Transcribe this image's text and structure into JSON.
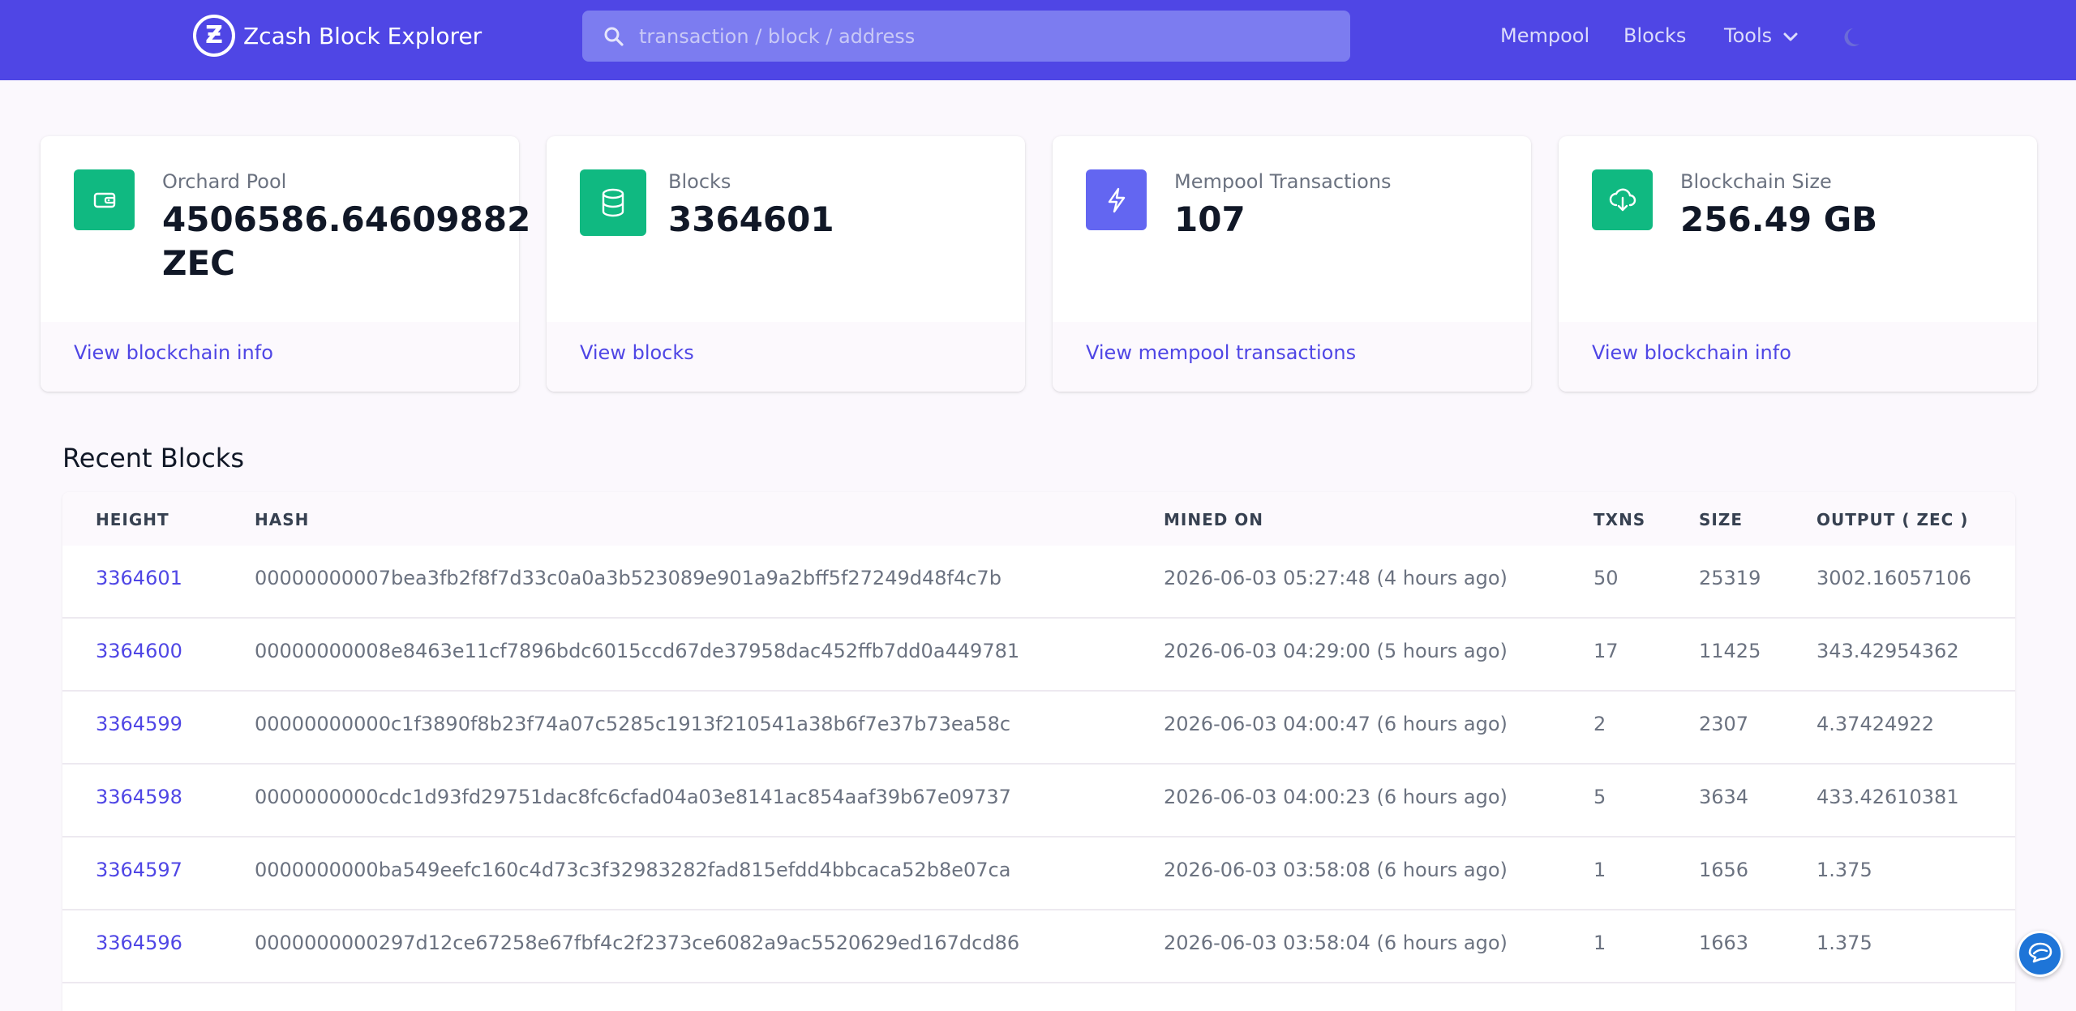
{
  "header": {
    "title": "Zcash Block Explorer",
    "logo_glyph": "Ƶ",
    "search_placeholder": "transaction / block / address",
    "nav": {
      "mempool": "Mempool",
      "blocks": "Blocks",
      "tools": "Tools"
    },
    "colors": {
      "background": "#4f46e5",
      "search_bg": "#7c7cf0"
    }
  },
  "cards": [
    {
      "label": "Orchard Pool",
      "value": "4506586.64609882\nZEC",
      "link": "View blockchain info",
      "icon": "wallet-icon",
      "icon_color": "#10b981"
    },
    {
      "label": "Blocks",
      "value": "3364601",
      "link": "View blocks",
      "icon": "database-icon",
      "icon_color": "#10b981"
    },
    {
      "label": "Mempool Transactions",
      "value": "107",
      "link": "View mempool transactions",
      "icon": "lightning-icon",
      "icon_color": "#6366f1"
    },
    {
      "label": "Blockchain Size",
      "value": "256.49 GB",
      "link": "View blockchain info",
      "icon": "cloud-download-icon",
      "icon_color": "#10b981"
    }
  ],
  "recent_blocks": {
    "title": "Recent Blocks",
    "columns": [
      "HEIGHT",
      "HASH",
      "MINED ON",
      "TXNS",
      "SIZE",
      "OUTPUT ( ZEC )"
    ],
    "rows": [
      {
        "height": "3364601",
        "hash": "00000000007bea3fb2f8f7d33c0a0a3b523089e901a9a2bff5f27249d48f4c7b",
        "mined_on": "2026-06-03 05:27:48 (4 hours ago)",
        "txns": "50",
        "size": "25319",
        "output": "3002.16057106"
      },
      {
        "height": "3364600",
        "hash": "00000000008e8463e11cf7896bdc6015ccd67de37958dac452ffb7dd0a449781",
        "mined_on": "2026-06-03 04:29:00 (5 hours ago)",
        "txns": "17",
        "size": "11425",
        "output": "343.42954362"
      },
      {
        "height": "3364599",
        "hash": "00000000000c1f3890f8b23f74a07c5285c1913f210541a38b6f7e37b73ea58c",
        "mined_on": "2026-06-03 04:00:47 (6 hours ago)",
        "txns": "2",
        "size": "2307",
        "output": "4.37424922"
      },
      {
        "height": "3364598",
        "hash": "0000000000cdc1d93fd29751dac8fc6cfad04a03e8141ac854aaf39b67e09737",
        "mined_on": "2026-06-03 04:00:23 (6 hours ago)",
        "txns": "5",
        "size": "3634",
        "output": "433.42610381"
      },
      {
        "height": "3364597",
        "hash": "0000000000ba549eefc160c4d73c3f32983282fad815efdd4bbcaca52b8e07ca",
        "mined_on": "2026-06-03 03:58:08 (6 hours ago)",
        "txns": "1",
        "size": "1656",
        "output": "1.375"
      },
      {
        "height": "3364596",
        "hash": "0000000000297d12ce67258e67fbf4c2f2373ce6082a9ac5520629ed167dcd86",
        "mined_on": "2026-06-03 03:58:04 (6 hours ago)",
        "txns": "1",
        "size": "1663",
        "output": "1.375"
      }
    ]
  },
  "chat_widget": {
    "icon": "chat-bubble-icon",
    "color": "#1e75d8"
  }
}
